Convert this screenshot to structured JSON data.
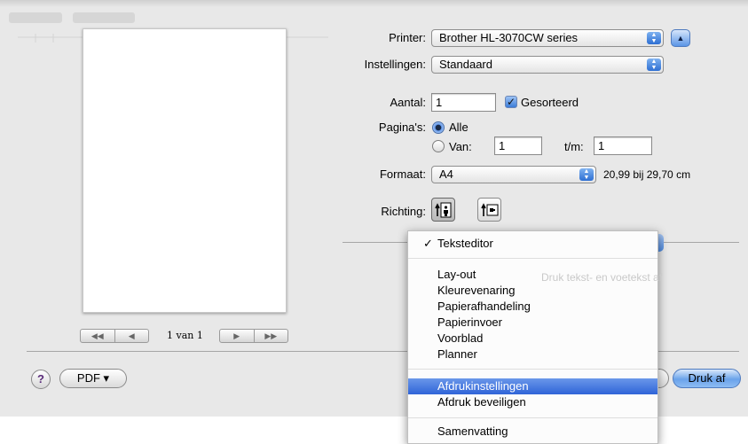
{
  "preview": {
    "page_indicator": "1 van 1",
    "nav_first": "◀◀",
    "nav_prev": "◀",
    "nav_next": "▶",
    "nav_last": "▶▶"
  },
  "printer": {
    "label": "Printer:",
    "value": "Brother HL-3070CW series"
  },
  "instellingen": {
    "label": "Instellingen:",
    "value": "Standaard"
  },
  "aantal": {
    "label": "Aantal:",
    "value": "1",
    "collated_label": "Gesorteerd",
    "collated_checked": true
  },
  "paginas": {
    "label": "Pagina's:",
    "all_label": "Alle",
    "from_label": "Van:",
    "from_value": "1",
    "to_label": "t/m:",
    "to_value": "1",
    "selected": "Alle"
  },
  "formaat": {
    "label": "Formaat:",
    "value": "A4",
    "size_text": "20,99 bij 29,70 cm"
  },
  "richting": {
    "label": "Richting:",
    "selected": "portrait"
  },
  "menu": {
    "checked_item": "Teksteditor",
    "selected_item": "Afdrukinstellingen",
    "groups": [
      [
        "Teksteditor"
      ],
      [
        "Lay-out",
        "Kleurevenaring",
        "Papierafhandeling",
        "Papierinvoer",
        "Voorblad",
        "Planner"
      ],
      [
        "Afdrukinstellingen",
        "Afdruk beveiligen"
      ],
      [
        "Samenvatting"
      ]
    ],
    "background_hint": "Druk tekst- en voetekst af"
  },
  "bottom": {
    "help": "?",
    "pdf_label": "PDF ▾",
    "print_label": "Druk af"
  },
  "colors": {
    "sheet_bg": "#e8e8e8",
    "highlight": "#3a6fdc",
    "aqua_blue": "#5a95e6"
  }
}
